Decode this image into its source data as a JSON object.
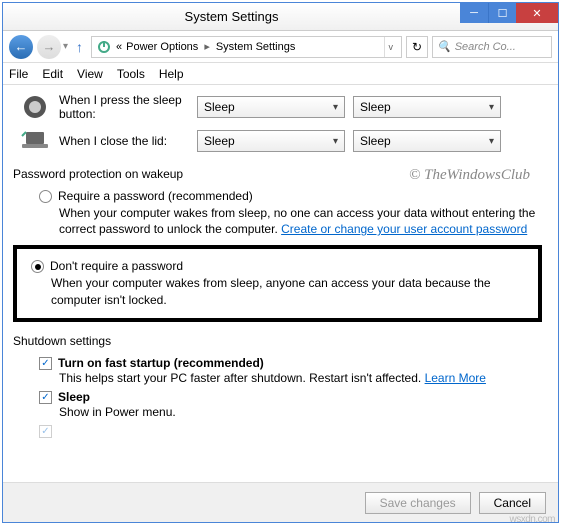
{
  "window": {
    "title": "System Settings"
  },
  "nav": {
    "crumb1": "Power Options",
    "crumb2": "System Settings",
    "search_placeholder": "Search Co..."
  },
  "menu": [
    "File",
    "Edit",
    "View",
    "Tools",
    "Help"
  ],
  "rows": {
    "sleep_btn": {
      "label": "When I press the sleep button:",
      "val1": "Sleep",
      "val2": "Sleep"
    },
    "close_lid": {
      "label": "When I close the lid:",
      "val1": "Sleep",
      "val2": "Sleep"
    }
  },
  "watermark": "© TheWindowsClub",
  "pwd_section": {
    "heading": "Password protection on wakeup",
    "require": {
      "label": "Require a password (recommended)",
      "desc_pre": "When your computer wakes from sleep, no one can access your data without entering the correct password to unlock the computer. ",
      "link": "Create or change your user account password"
    },
    "norequire": {
      "label": "Don't require a password",
      "desc": "When your computer wakes from sleep, anyone can access your data because the computer isn't locked."
    }
  },
  "shutdown_section": {
    "heading": "Shutdown settings",
    "fast": {
      "label": "Turn on fast startup (recommended)",
      "desc_pre": "This helps start your PC faster after shutdown. Restart isn't affected. ",
      "link": "Learn More"
    },
    "sleep": {
      "label": "Sleep",
      "desc": "Show in Power menu."
    }
  },
  "footer": {
    "save": "Save changes",
    "cancel": "Cancel"
  },
  "wsx": "wsxdn.com"
}
